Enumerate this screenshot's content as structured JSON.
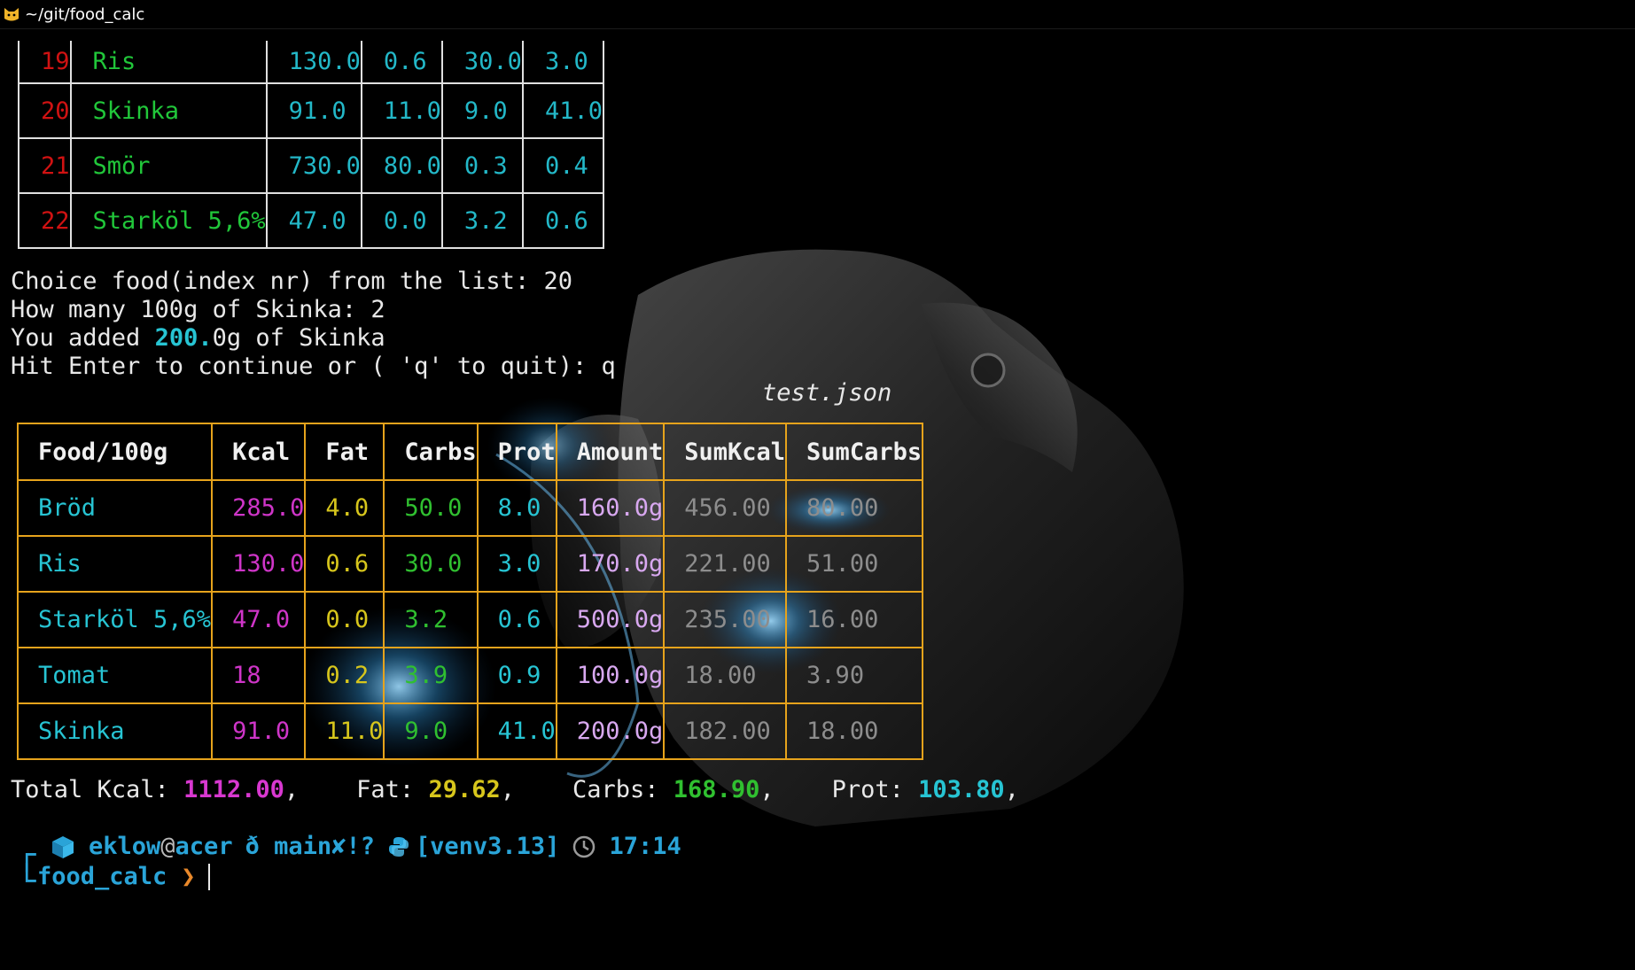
{
  "window": {
    "title": "~/git/food_calc"
  },
  "top_table": {
    "rows": [
      {
        "index": "19",
        "name": "Ris",
        "kcal": "130.0",
        "fat": "0.6",
        "carbs": "30.0",
        "prot": "3.0"
      },
      {
        "index": "20",
        "name": "Skinka",
        "kcal": "91.0",
        "fat": "11.0",
        "carbs": "9.0",
        "prot": "41.0"
      },
      {
        "index": "21",
        "name": "Smör",
        "kcal": "730.0",
        "fat": "80.0",
        "carbs": "0.3",
        "prot": "0.4"
      },
      {
        "index": "22",
        "name": "Starköl 5,6%",
        "kcal": "47.0",
        "fat": "0.0",
        "carbs": "3.2",
        "prot": "0.6"
      }
    ]
  },
  "dialog": {
    "line1": "Choice food(index nr) from the list: 20",
    "line2": "How many 100g of Skinka: 2",
    "line3_prefix": "You added ",
    "line3_value": "200.",
    "line3_suffix": "0g of Skinka",
    "line4": "Hit Enter to continue or ( 'q' to quit): q"
  },
  "summary_table": {
    "caption": "test.json",
    "headers": [
      "Food/100g",
      "Kcal",
      "Fat",
      "Carbs",
      "Prot",
      "Amount",
      "SumKcal",
      "SumCarbs"
    ],
    "rows": [
      [
        "Bröd",
        "285.0",
        "4.0",
        "50.0",
        "8.0",
        "160.0g",
        "456.00",
        "80.00"
      ],
      [
        "Ris",
        "130.0",
        "0.6",
        "30.0",
        "3.0",
        "170.0g",
        "221.00",
        "51.00"
      ],
      [
        "Starköl 5,6%",
        "47.0",
        "0.0",
        "3.2",
        "0.6",
        "500.0g",
        "235.00",
        "16.00"
      ],
      [
        "Tomat",
        "18",
        "0.2",
        "3.9",
        "0.9",
        "100.0g",
        "18.00",
        "3.90"
      ],
      [
        "Skinka",
        "91.0",
        "11.0",
        "9.0",
        "41.0",
        "200.0g",
        "182.00",
        "18.00"
      ]
    ]
  },
  "totals": {
    "kcal_label": "Total Kcal: ",
    "kcal": "1112.00",
    "fat_label": ",    Fat: ",
    "fat": "29.62",
    "carbs_label": ",    Carbs: ",
    "carbs": "168.90",
    "prot_label": ",    Prot: ",
    "prot": "103.80",
    "trail": ","
  },
  "shell_prompt": {
    "bracket_top": "┌",
    "bracket_bottom": "└",
    "user": "eklow",
    "at": "@",
    "host": "acer",
    "branch_glyph": "ð",
    "branch": " main✘!?",
    "venv": "[venv3.13]",
    "time": "17:14",
    "dir": "food_calc",
    "arrow": "❯"
  },
  "colors": {
    "table_border_main": "#e6a31c",
    "table_border_top": "#e0e0e0",
    "index": "#d01212",
    "name": "#21c73a",
    "cyan": "#27c4d3",
    "magenta": "#cf35c8",
    "yellow": "#d7c61c",
    "green": "#30c030",
    "lavender": "#d8a8f0",
    "grey": "#8d8d8d",
    "prompt_blue": "#2aa4d8",
    "arrow": "#e8882a"
  },
  "icons": [
    "cat-icon",
    "cube-icon",
    "python-icon",
    "clock-icon"
  ]
}
